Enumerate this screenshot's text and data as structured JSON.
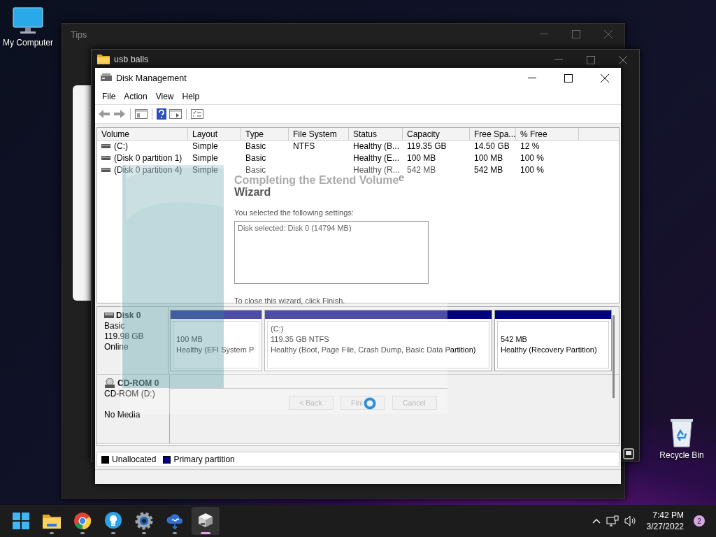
{
  "desktop_icons": [
    {
      "label": "My Computer",
      "kind": "monitor"
    },
    {
      "label": "Recycle Bin",
      "kind": "recycle"
    }
  ],
  "tips_window": {
    "title": "Tips"
  },
  "explorer_window": {
    "title": "usb balls"
  },
  "disk_management": {
    "title": "Disk Management",
    "menu": [
      "File",
      "Action",
      "View",
      "Help"
    ],
    "columns": [
      "Volume",
      "Layout",
      "Type",
      "File System",
      "Status",
      "Capacity",
      "Free Spa...",
      "% Free"
    ],
    "rows": [
      {
        "cells": [
          "(C:)",
          "Simple",
          "Basic",
          "NTFS",
          "Healthy (B...",
          "119.35 GB",
          "14.50 GB",
          "12 %"
        ]
      },
      {
        "cells": [
          "(Disk 0 partition 1)",
          "Simple",
          "Basic",
          "",
          "Healthy (E...",
          "100 MB",
          "100 MB",
          "100 %"
        ]
      },
      {
        "cells": [
          "(Disk 0 partition 4)",
          "Simple",
          "Basic",
          "",
          "Healthy (R...",
          "542 MB",
          "542 MB",
          "100 %"
        ]
      }
    ],
    "disks": [
      {
        "name": "Disk 0",
        "kind": "disk",
        "lines": [
          "Basic",
          "119.98 GB",
          "Online"
        ],
        "partitions": [
          {
            "lines": [
              "100 MB",
              "Healthy (EFI System P"
            ]
          },
          {
            "lines": [
              "(C:)",
              "119.35 GB NTFS",
              "Healthy (Boot, Page File, Crash Dump, Basic Data Partition)"
            ]
          },
          {
            "lines": [
              "542 MB",
              "Healthy (Recovery Partition)"
            ]
          }
        ]
      },
      {
        "name": "CD-ROM 0",
        "kind": "cdrom",
        "lines": [
          "CD-ROM (D:)",
          "No Media"
        ]
      }
    ],
    "legend": [
      {
        "label": "Unallocated",
        "color": "#000000"
      },
      {
        "label": "Primary partition",
        "color": "#000080"
      }
    ]
  },
  "wizard": {
    "title": "Completing the Extend Volume",
    "title_fragment": "e",
    "title_2": "Wizard",
    "settings_label": "You selected the following settings:",
    "settings": "Disk selected: Disk 0 (14794 MB)",
    "close_hint": "To close this wizard, click Finish.",
    "buttons": [
      "< Back",
      "Fini",
      "Cancel"
    ]
  },
  "taskbar": {
    "apps": [
      {
        "kind": "start",
        "running": false,
        "selected": false
      },
      {
        "kind": "folder",
        "running": true,
        "selected": false
      },
      {
        "kind": "browser",
        "running": true,
        "selected": false
      },
      {
        "kind": "bulb",
        "running": true,
        "selected": false
      },
      {
        "kind": "gear",
        "running": true,
        "selected": false
      },
      {
        "kind": "cloud",
        "running": true,
        "selected": false
      },
      {
        "kind": "drive",
        "running": true,
        "selected": true
      }
    ],
    "time": "7:42 PM",
    "date": "3/27/2022",
    "notifications": "2"
  }
}
